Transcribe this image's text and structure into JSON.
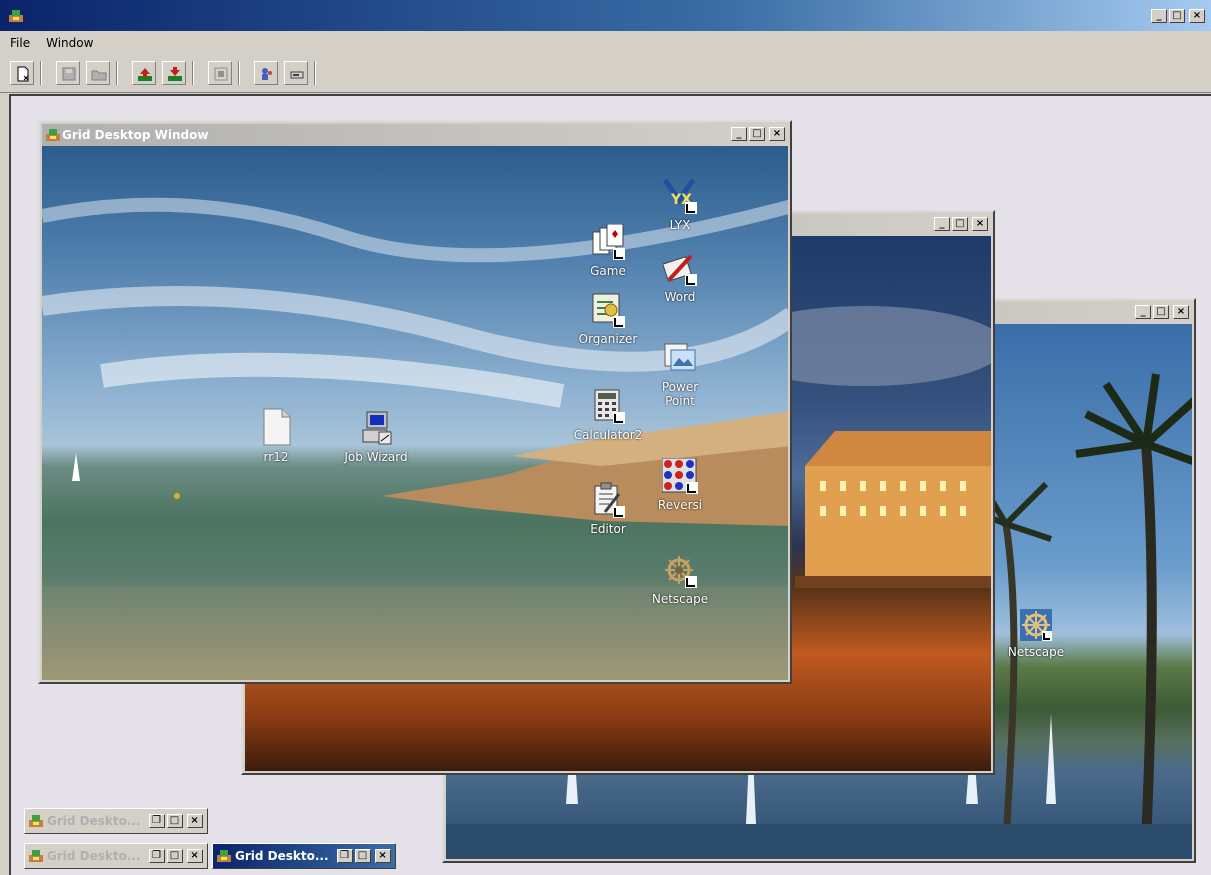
{
  "app": {
    "menu": [
      "File",
      "Window"
    ],
    "buttons": [
      "new",
      "save",
      "folder",
      "upload",
      "download",
      "grid",
      "users",
      "network"
    ]
  },
  "windows": {
    "front": {
      "title": "Grid Desktop Window",
      "icons": [
        {
          "label": "rr12",
          "icon": "document-icon"
        },
        {
          "label": "Job Wizard",
          "icon": "computer-wizard-icon"
        },
        {
          "label": "Game",
          "icon": "cards-icon"
        },
        {
          "label": "LYX",
          "icon": "lyx-icon"
        },
        {
          "label": "Word",
          "icon": "word-icon"
        },
        {
          "label": "Organizer",
          "icon": "organizer-icon"
        },
        {
          "label": "Power\nPoint",
          "icon": "powerpoint-icon"
        },
        {
          "label": "Calculator2",
          "icon": "calculator-icon"
        },
        {
          "label": "Reversi",
          "icon": "reversi-icon"
        },
        {
          "label": "Editor",
          "icon": "editor-icon"
        },
        {
          "label": "Netscape",
          "icon": "netscape-icon"
        }
      ]
    },
    "middle": {
      "title": ""
    },
    "back": {
      "title": "",
      "icons": [
        {
          "label": "Netscape",
          "icon": "netscape-icon"
        }
      ]
    }
  },
  "minimized": [
    {
      "title": "Grid Deskto...",
      "active": false
    },
    {
      "title": "Grid Deskto...",
      "active": false
    },
    {
      "title": "Grid Deskto...",
      "active": true
    }
  ],
  "colors": {
    "titlebar_start": "#0a246a",
    "titlebar_end": "#a6caf0",
    "mdi_bg": "#e4e2e8"
  }
}
